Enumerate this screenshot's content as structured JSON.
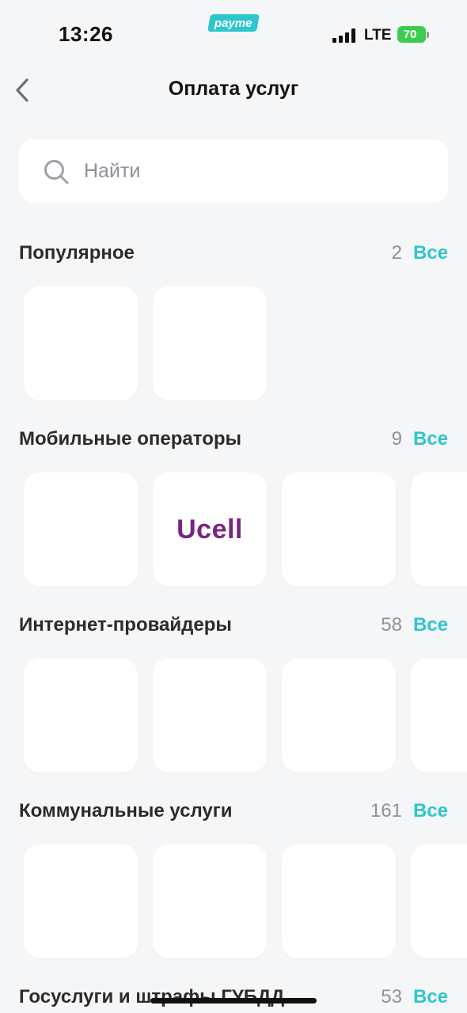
{
  "status_bar": {
    "time": "13:26",
    "app_badge": "payme",
    "network": "LTE",
    "battery": "70"
  },
  "header": {
    "title": "Оплата услуг",
    "back_icon": "chevron-left-icon"
  },
  "search": {
    "placeholder": "Найти",
    "value": "",
    "icon": "search-icon"
  },
  "colors": {
    "accent": "#2cc6cc",
    "background": "#f5f6f8",
    "tile": "#ffffff",
    "ucell_brand": "#7a2582"
  },
  "sections": [
    {
      "title": "Популярное",
      "count": "2",
      "all_label": "Все",
      "tiles": [
        {
          "label": ""
        },
        {
          "label": ""
        }
      ]
    },
    {
      "title": "Мобильные операторы",
      "count": "9",
      "all_label": "Все",
      "tiles": [
        {
          "label": ""
        },
        {
          "label": "Ucell"
        },
        {
          "label": ""
        },
        {
          "label": ""
        }
      ]
    },
    {
      "title": "Интернет-провайдеры",
      "count": "58",
      "all_label": "Все",
      "tiles": [
        {
          "label": ""
        },
        {
          "label": ""
        },
        {
          "label": ""
        },
        {
          "label": ""
        }
      ]
    },
    {
      "title": "Коммунальные услуги",
      "count": "161",
      "all_label": "Все",
      "tiles": [
        {
          "label": ""
        },
        {
          "label": ""
        },
        {
          "label": ""
        },
        {
          "label": ""
        }
      ]
    },
    {
      "title": "Госуслуги и штрафы ГУБДД",
      "count": "53",
      "all_label": "Все",
      "tiles": []
    }
  ]
}
